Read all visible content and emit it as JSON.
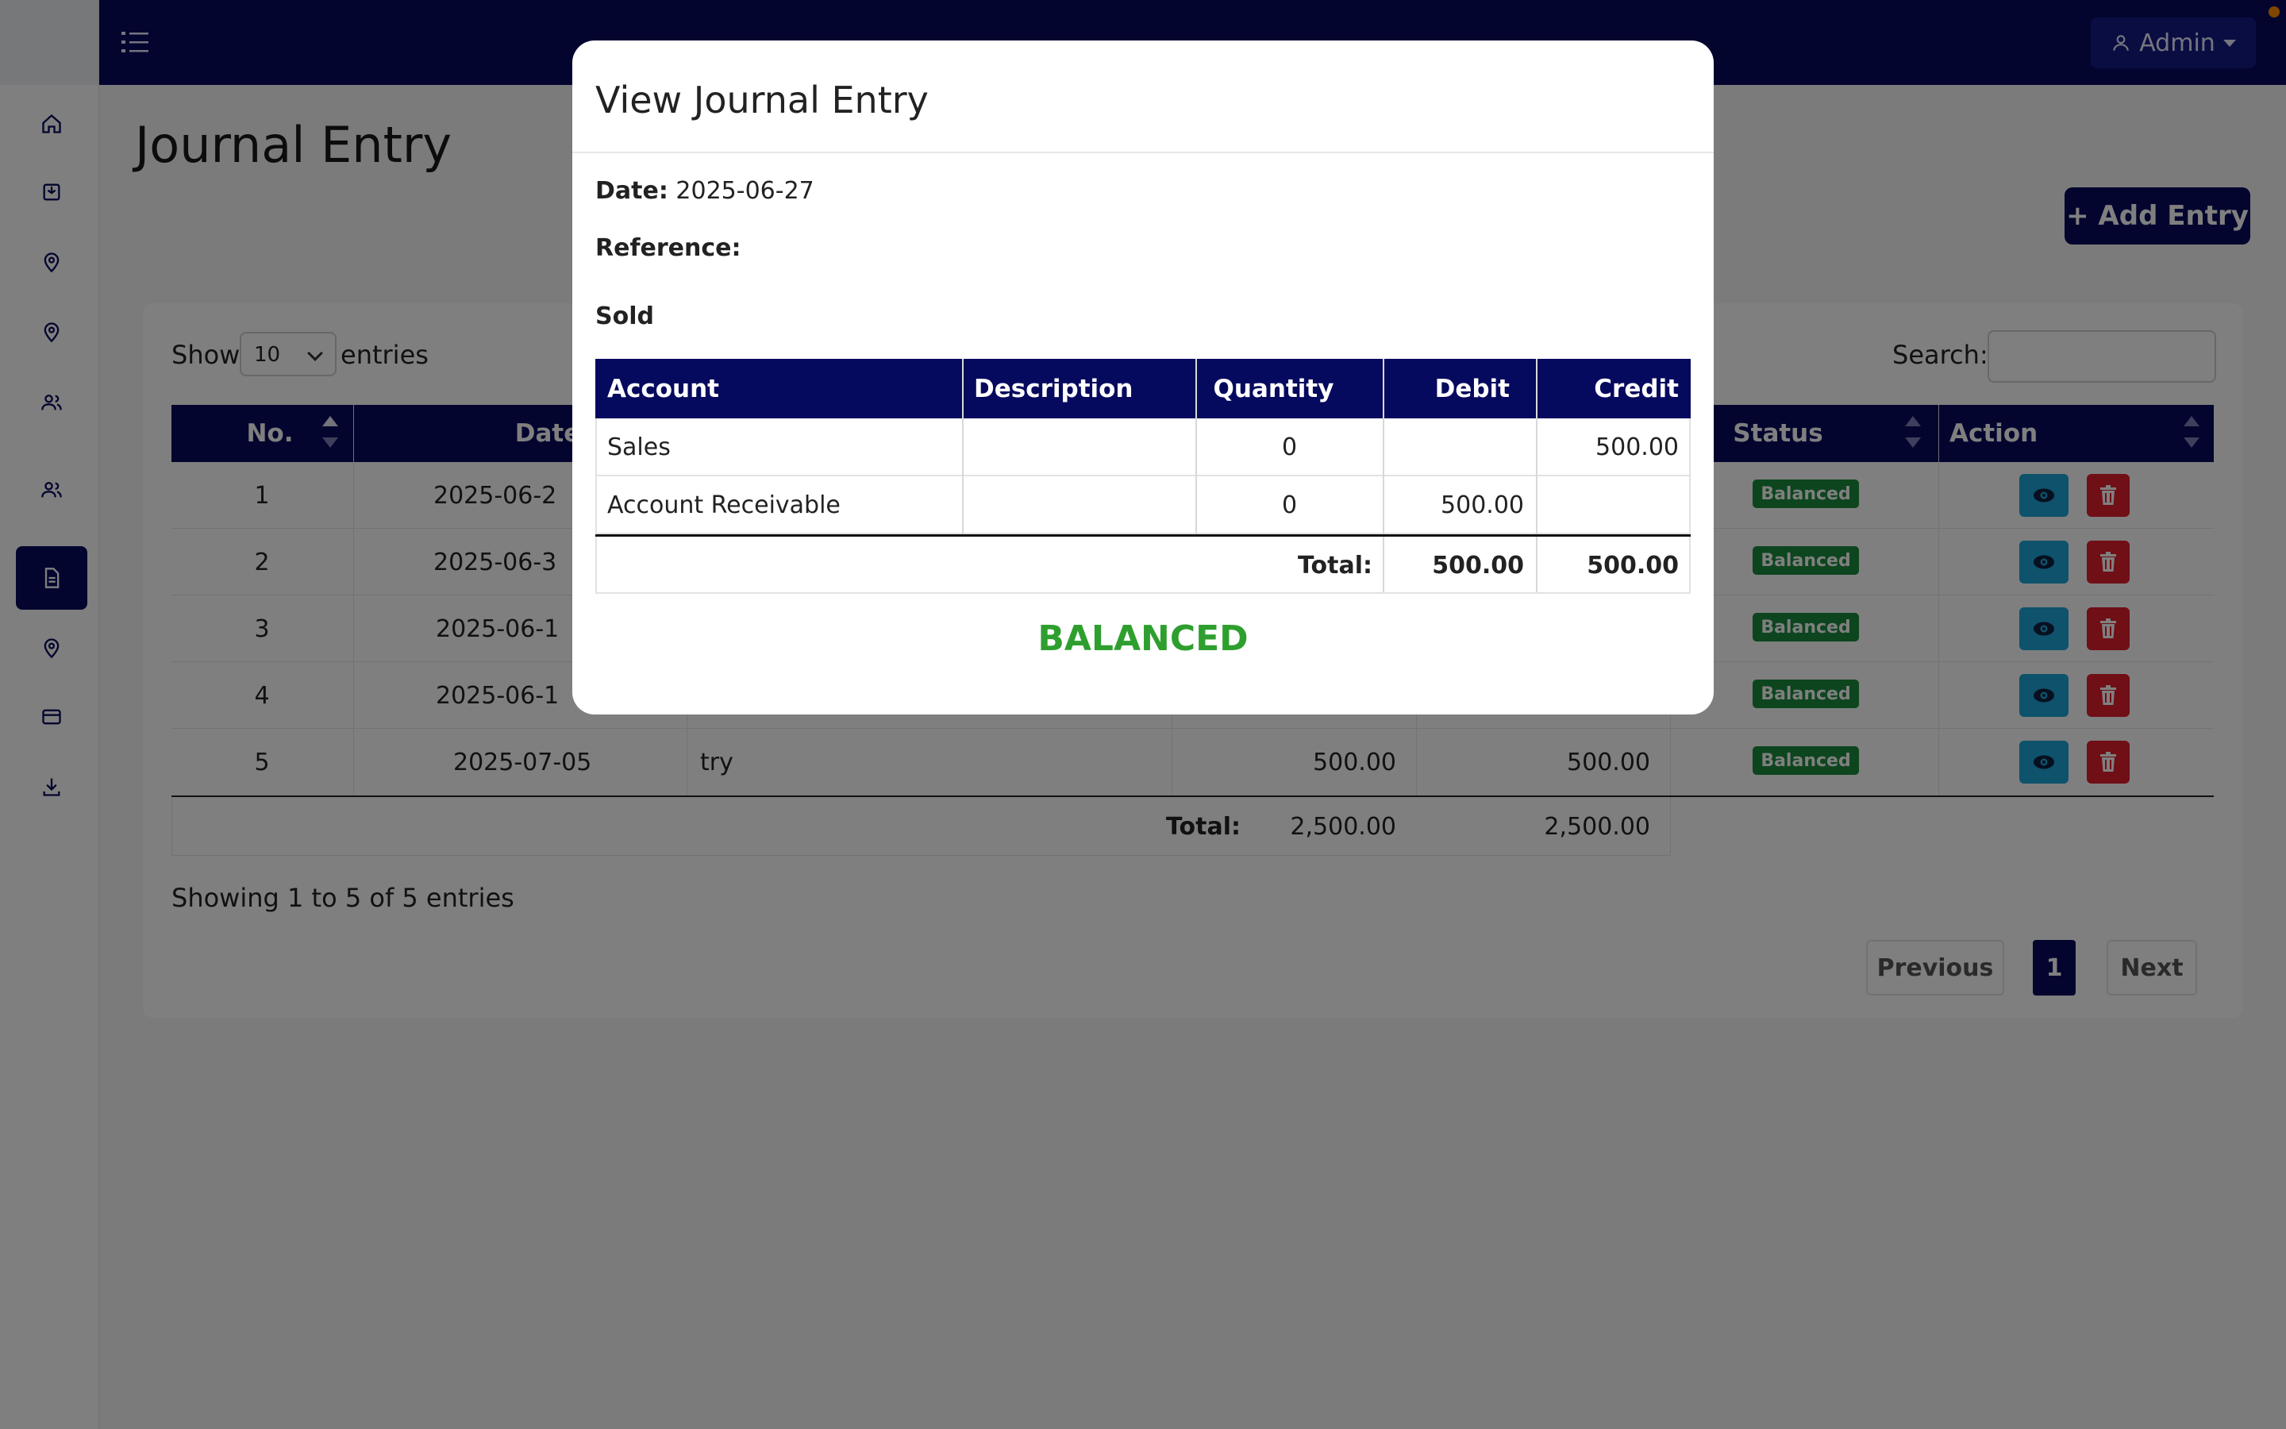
{
  "header": {
    "admin_label": "Admin"
  },
  "sidebar": {
    "items": [
      {
        "icon": "home-icon"
      },
      {
        "icon": "inbox-icon"
      },
      {
        "icon": "location-pin-icon"
      },
      {
        "icon": "location-pin-icon"
      },
      {
        "icon": "users-icon"
      },
      {
        "icon": "users-icon"
      },
      {
        "icon": "document-icon",
        "active": true
      },
      {
        "icon": "location-pin-icon"
      },
      {
        "icon": "credit-card-icon"
      },
      {
        "icon": "download-icon"
      }
    ]
  },
  "page": {
    "title": "Journal Entry",
    "add_button": "+ Add Entry"
  },
  "table_controls": {
    "show_label": "Show",
    "page_length": "10",
    "entries_label": "entries",
    "search_label": "Search:",
    "search_value": ""
  },
  "table": {
    "columns": {
      "no": "No.",
      "date": "Date",
      "status": "Status",
      "action": "Action"
    },
    "rows": [
      {
        "no": "1",
        "date": "2025-06-2",
        "description": "",
        "debit": "",
        "credit": "",
        "status": "Balanced"
      },
      {
        "no": "2",
        "date": "2025-06-3",
        "description": "",
        "debit": "",
        "credit": "",
        "status": "Balanced"
      },
      {
        "no": "3",
        "date": "2025-06-1",
        "description": "",
        "debit": "",
        "credit": "",
        "status": "Balanced"
      },
      {
        "no": "4",
        "date": "2025-06-1",
        "description": "",
        "debit": "",
        "credit": "",
        "status": "Balanced"
      },
      {
        "no": "5",
        "date": "2025-07-05",
        "description": "try",
        "debit": "500.00",
        "credit": "500.00",
        "status": "Balanced"
      }
    ],
    "footer": {
      "total_label": "Total:",
      "total_debit": "2,500.00",
      "total_credit": "2,500.00"
    },
    "info": "Showing 1 to 5 of 5 entries",
    "pagination": {
      "previous": "Previous",
      "current": "1",
      "next": "Next"
    }
  },
  "modal": {
    "title": "View Journal Entry",
    "date_label": "Date:",
    "date_value": "2025-06-27",
    "reference_label": "Reference:",
    "reference_value": "",
    "memo": "Sold",
    "columns": {
      "account": "Account",
      "description": "Description",
      "quantity": "Quantity",
      "debit": "Debit",
      "credit": "Credit"
    },
    "lines": [
      {
        "account": "Sales",
        "description": "",
        "quantity": "0",
        "debit": "",
        "credit": "500.00"
      },
      {
        "account": "Account Receivable",
        "description": "",
        "quantity": "0",
        "debit": "500.00",
        "credit": ""
      }
    ],
    "total_label": "Total:",
    "total_debit": "500.00",
    "total_credit": "500.00",
    "status": "BALANCED",
    "status_color": "#2e9f2e"
  },
  "colors": {
    "brand_navy": "#060a5e",
    "view_button": "#1ca5d8",
    "delete_button": "#e01e2b",
    "badge_green": "#1a8a3d"
  }
}
